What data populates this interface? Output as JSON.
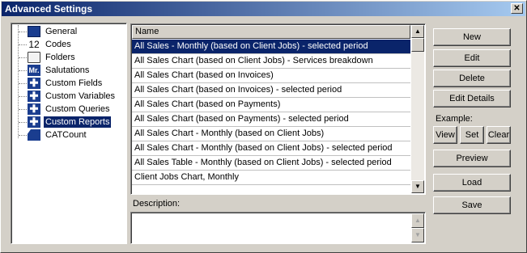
{
  "window": {
    "title": "Advanced Settings",
    "close_glyph": "✕"
  },
  "tree": {
    "items": [
      {
        "label": "General",
        "icon": "book-icon",
        "selected": false
      },
      {
        "label": "Codes",
        "icon": "number-icon",
        "icon_text": "12",
        "selected": false
      },
      {
        "label": "Folders",
        "icon": "folder-icon",
        "selected": false
      },
      {
        "label": "Salutations",
        "icon": "salutation-icon",
        "icon_text": "Mr.",
        "selected": false
      },
      {
        "label": "Custom Fields",
        "icon": "plus-icon",
        "icon_text": "✚",
        "selected": false
      },
      {
        "label": "Custom Variables",
        "icon": "plus-icon",
        "icon_text": "✚",
        "selected": false
      },
      {
        "label": "Custom Queries",
        "icon": "plus-icon",
        "icon_text": "✚",
        "selected": false
      },
      {
        "label": "Custom Reports",
        "icon": "plus-icon",
        "icon_text": "✚",
        "selected": true
      },
      {
        "label": "CATCount",
        "icon": "catcount-icon",
        "selected": false
      }
    ]
  },
  "list": {
    "header": "Name",
    "rows": [
      "All Sales - Monthly (based on Client Jobs) - selected period",
      "All Sales Chart (based on Client Jobs) - Services breakdown",
      "All Sales Chart (based on Invoices)",
      "All Sales Chart (based on Invoices) - selected period",
      "All Sales Chart (based on Payments)",
      "All Sales Chart (based on Payments) - selected period",
      "All Sales Chart - Monthly (based on Client Jobs)",
      "All Sales Chart - Monthly (based on Client Jobs) - selected period",
      "All Sales Table - Monthly (based on Client Jobs) - selected period",
      "Client Jobs Chart, Monthly"
    ],
    "selected_index": 0
  },
  "description": {
    "label": "Description:",
    "value": ""
  },
  "buttons": {
    "new": "New",
    "edit": "Edit",
    "delete": "Delete",
    "edit_details": "Edit Details",
    "example_label": "Example:",
    "view": "View",
    "set": "Set",
    "clear": "Clear",
    "preview": "Preview",
    "load": "Load",
    "save": "Save"
  },
  "scroll": {
    "up_glyph": "▲",
    "down_glyph": "▼"
  },
  "colors": {
    "selection": "#0a246a",
    "titlebar": "#0a246a",
    "face": "#d4d0c8"
  }
}
